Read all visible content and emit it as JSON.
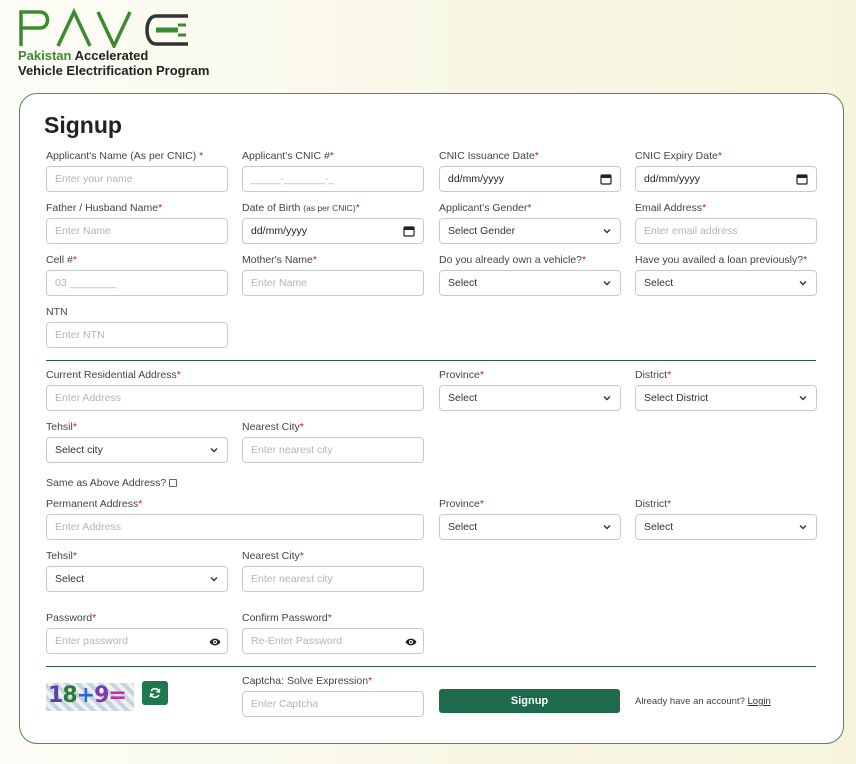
{
  "brand": {
    "logo_text": "PAVE",
    "line1_green": "Pakistan",
    "line1_rest": " Accelerated",
    "line2": "Vehicle Electrification Program",
    "colors": {
      "green": "#3c8a2f",
      "dark": "#333333"
    }
  },
  "form": {
    "title": "Signup",
    "applicant_name": {
      "label": "Applicant's Name (As per CNIC) ",
      "placeholder": "Enter your name"
    },
    "cnic": {
      "label": "Applicant's CNIC #",
      "placeholder": "_____-_______-_"
    },
    "cnic_issue": {
      "label": "CNIC Issuance Date",
      "value": "dd/mm/yyyy"
    },
    "cnic_expiry": {
      "label": "CNIC Expiry Date",
      "value": "dd/mm/yyyy"
    },
    "father_name": {
      "label": "Father / Husband Name",
      "placeholder": "Enter Name"
    },
    "dob": {
      "label": "Date of Birth ",
      "label_small": "(as per CNIC)",
      "value": "dd/mm/yyyy"
    },
    "gender": {
      "label": "Applicant's Gender",
      "value": "Select Gender"
    },
    "email": {
      "label": "Email Address",
      "placeholder": "Enter email address"
    },
    "cell": {
      "label": "Cell #",
      "placeholder": "03 ________"
    },
    "mother_name": {
      "label": "Mother's Name",
      "placeholder": "Enter Name"
    },
    "own_vehicle": {
      "label": "Do you already own a vehicle?",
      "value": "Select"
    },
    "loan": {
      "label": "Have you availed a loan previously?",
      "value": "Select"
    },
    "ntn": {
      "label": "NTN",
      "placeholder": "Enter NTN"
    },
    "current_address": {
      "label": "Current Residential Address",
      "placeholder": "Enter Address"
    },
    "province1": {
      "label": "Province",
      "value": "Select"
    },
    "district1": {
      "label": "District",
      "value": "Select District"
    },
    "tehsil1": {
      "label": "Tehsil",
      "value": "Select city"
    },
    "nearest_city1": {
      "label": "Nearest City",
      "placeholder": "Enter nearest city"
    },
    "same_as_above": "Same as Above Address?",
    "permanent_address": {
      "label": "Permanent Address",
      "placeholder": "Enter Address"
    },
    "province2": {
      "label": "Province",
      "value": "Select"
    },
    "district2": {
      "label": "District",
      "value": "Select"
    },
    "tehsil2": {
      "label": "Tehsil",
      "value": "Select"
    },
    "nearest_city2": {
      "label": "Nearest City",
      "placeholder": "Enter nearest city"
    },
    "password": {
      "label": "Password",
      "placeholder": "Enter password"
    },
    "confirm_password": {
      "label": "Confirm Password",
      "placeholder": "Re-Enter Password"
    },
    "captcha": {
      "label": "Captcha: Solve Expression",
      "placeholder": "Enter Captcha",
      "parts": [
        "1",
        "8",
        "+",
        "9",
        "="
      ]
    },
    "signup_button": "Signup",
    "account_prompt": "Already have an account? ",
    "login_link": "Login",
    "required_mark": "*",
    "colors": {
      "accent": "#1e6b4b",
      "required": "#dd1122",
      "border": "#4f8a5d"
    }
  }
}
